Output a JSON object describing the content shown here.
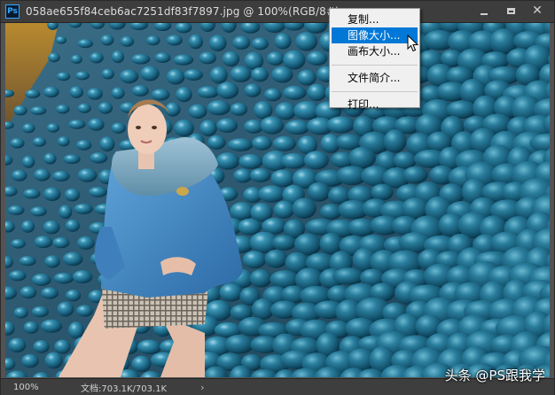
{
  "window": {
    "app_icon_label": "Ps",
    "title": "058ae655f84ceb6ac7251df83f7897.jpg @ 100%(RGB/8#)"
  },
  "context_menu": {
    "items": [
      {
        "label": "复制..."
      },
      {
        "label": "图像大小..."
      },
      {
        "label": "画布大小..."
      },
      {
        "label": "文件简介..."
      },
      {
        "label": "打印..."
      }
    ],
    "active_index": 1
  },
  "statusbar": {
    "zoom": "100%",
    "document": "文档:703.1K/703.1K",
    "arrow": "›"
  },
  "watermark": "头条 @PS跟我学",
  "colors": {
    "titlebar": "#3d3d3d",
    "menu_highlight": "#0078d7",
    "menu_bg": "#f0f0f0",
    "pebble": "#1f6f8f",
    "coat": "#3b86c4"
  }
}
